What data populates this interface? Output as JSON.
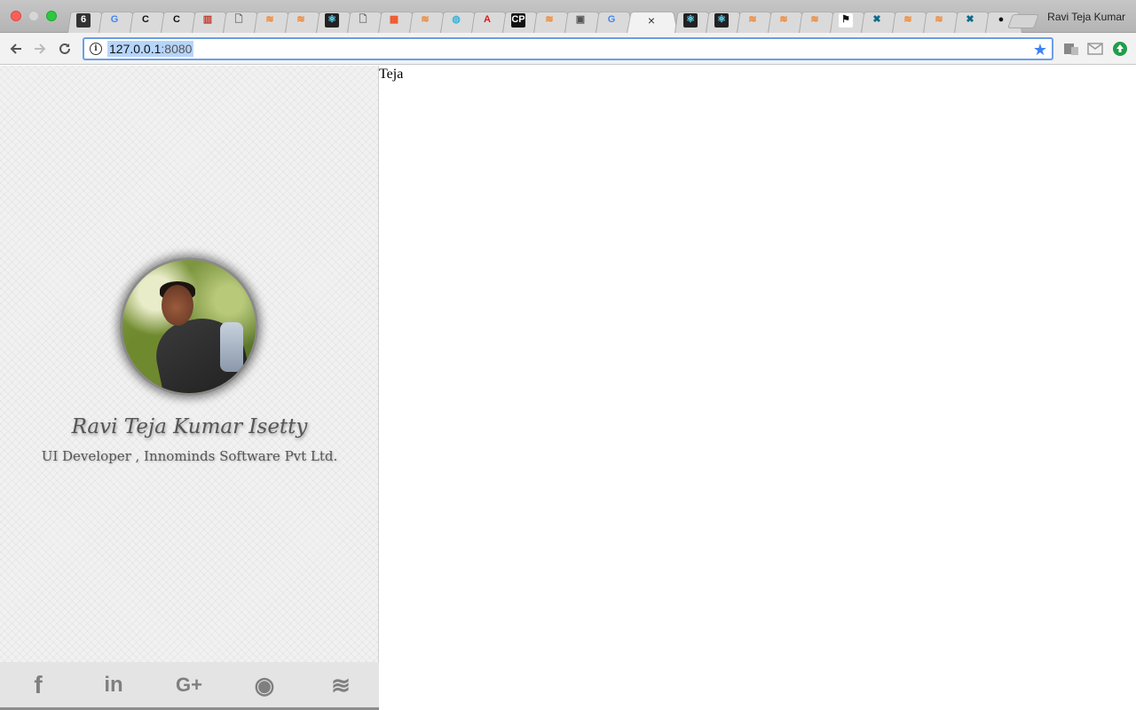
{
  "browser": {
    "profile_name": "Ravi Teja Kumar",
    "tabs": [
      {
        "icon": "eap-icon",
        "glyph": "6"
      },
      {
        "icon": "google-icon",
        "glyph": "G"
      },
      {
        "icon": "c-icon",
        "glyph": "C"
      },
      {
        "icon": "c-icon",
        "glyph": "C"
      },
      {
        "icon": "chart-icon",
        "glyph": "▥"
      },
      {
        "icon": "document-icon",
        "glyph": "🗋"
      },
      {
        "icon": "stackoverflow-icon",
        "glyph": "≋"
      },
      {
        "icon": "stackoverflow-icon",
        "glyph": "≋"
      },
      {
        "icon": "react-icon",
        "glyph": "⚛"
      },
      {
        "icon": "document-icon",
        "glyph": "🗋"
      },
      {
        "icon": "microsoft-icon",
        "glyph": "▦"
      },
      {
        "icon": "stackoverflow-icon",
        "glyph": "≋"
      },
      {
        "icon": "globe-icon",
        "glyph": "◍"
      },
      {
        "icon": "angular-icon",
        "glyph": "A"
      },
      {
        "icon": "codepen-icon",
        "glyph": "CP"
      },
      {
        "icon": "stackoverflow-icon",
        "glyph": "≋"
      },
      {
        "icon": "terminal-icon",
        "glyph": "▣"
      },
      {
        "icon": "google-icon",
        "glyph": "G"
      },
      {
        "icon": "react-icon",
        "glyph": "⚛"
      },
      {
        "icon": "react-icon",
        "glyph": "⚛"
      },
      {
        "icon": "stackoverflow-icon",
        "glyph": "≋"
      },
      {
        "icon": "stackoverflow-icon",
        "glyph": "≋"
      },
      {
        "icon": "stackoverflow-icon",
        "glyph": "≋"
      },
      {
        "icon": "flag-icon",
        "glyph": "⚑"
      },
      {
        "icon": "x-circle-icon",
        "glyph": "✖"
      },
      {
        "icon": "stackoverflow-icon",
        "glyph": "≋"
      },
      {
        "icon": "stackoverflow-icon",
        "glyph": "≋"
      },
      {
        "icon": "x-circle-icon",
        "glyph": "✖"
      },
      {
        "icon": "github-icon",
        "glyph": "●"
      }
    ],
    "active_tab_close": "×",
    "url": {
      "host": "127.0.0.1",
      "port": ":8080"
    }
  },
  "sidebar": {
    "name": "Ravi Teja Kumar Isetty",
    "role": "UI Developer , Innominds Software Pvt Ltd.",
    "social": [
      {
        "icon": "facebook-icon",
        "glyph": "f"
      },
      {
        "icon": "linkedin-icon",
        "glyph": "in"
      },
      {
        "icon": "google-plus-icon",
        "glyph": "G+"
      },
      {
        "icon": "github-icon",
        "glyph": "◉"
      },
      {
        "icon": "stackoverflow-icon",
        "glyph": "≋"
      }
    ]
  },
  "main": {
    "text": "Teja"
  },
  "colors": {
    "accent": "#3b82f6",
    "sidebar_bg": "#f1f1f1",
    "text_gray": "#555555"
  }
}
